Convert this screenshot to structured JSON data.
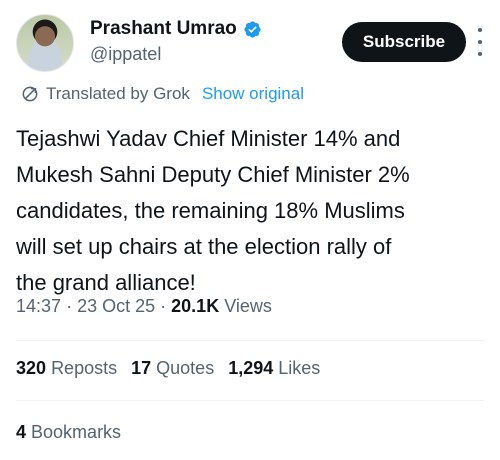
{
  "author": {
    "name": "Prashant Umrao",
    "handle": "@ippatel",
    "verified_color": "#1d9bf0"
  },
  "subscribe_label": "Subscribe",
  "translation": {
    "translated_by": "Translated by Grok",
    "show_original": "Show original",
    "icon": "translate-icon"
  },
  "tweet": {
    "line1": "Tejashwi Yadav Chief Minister 14% and",
    "line2": "Mukesh Sahni Deputy Chief Minister 2%",
    "line3": "candidates, the remaining 18% Muslims",
    "line4": "will set up chairs at the election rally of",
    "line5": "the grand alliance!"
  },
  "meta": {
    "time": "14:37",
    "date": "23 Oct 25",
    "views_count": "20.1K",
    "views_label": "Views"
  },
  "stats": {
    "reposts_count": "320",
    "reposts_label": "Reposts",
    "quotes_count": "17",
    "quotes_label": "Quotes",
    "likes_count": "1,294",
    "likes_label": "Likes",
    "bookmarks_count": "4",
    "bookmarks_label": "Bookmarks"
  },
  "colors": {
    "text": "#0f1419",
    "secondary": "#536471",
    "link": "#1d9bf0",
    "button_bg": "#0f1419"
  }
}
